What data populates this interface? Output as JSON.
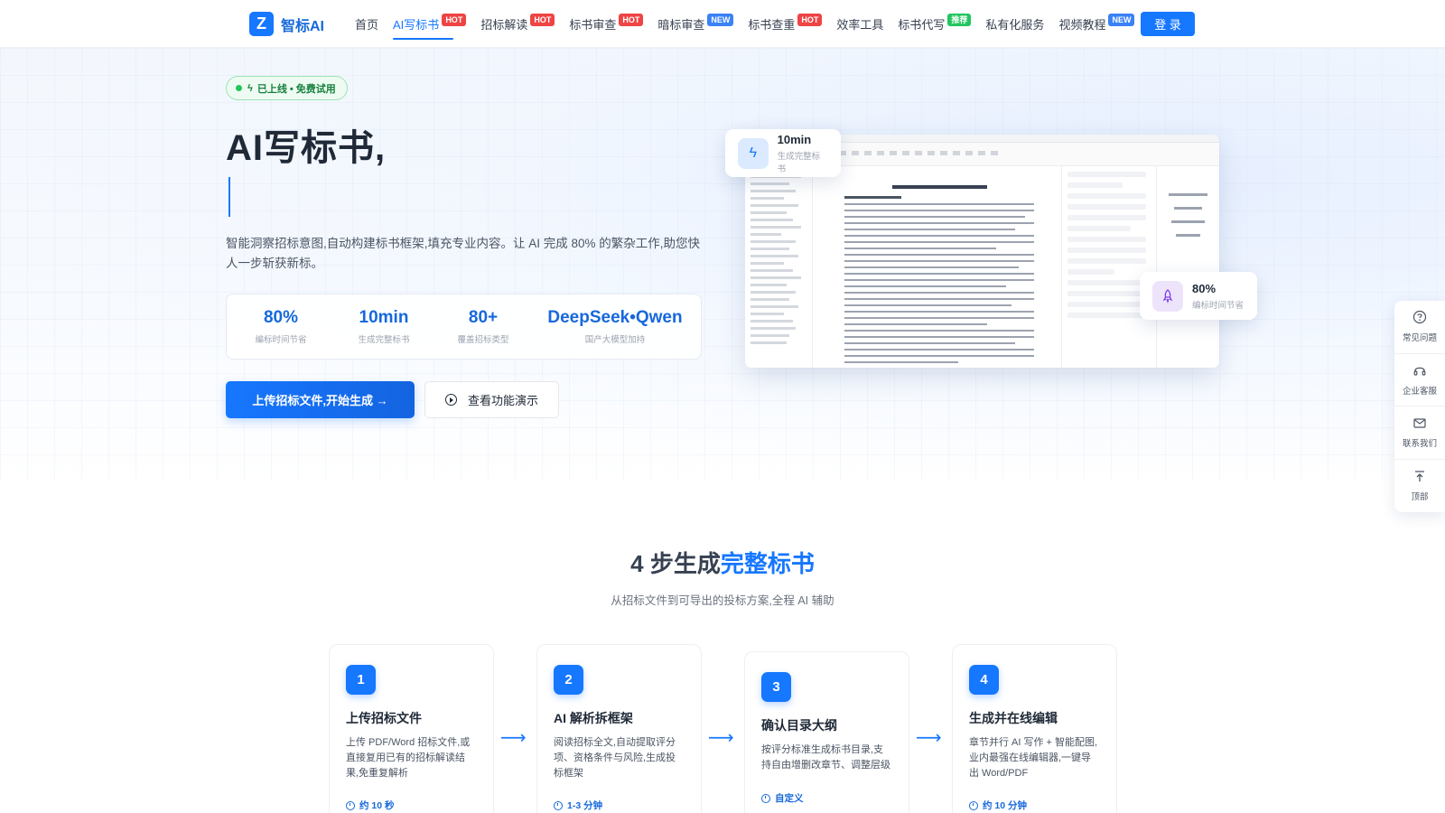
{
  "nav": {
    "logo_mark": "Z",
    "logo_text": "智标AI",
    "items": [
      {
        "label": "首页",
        "badge": ""
      },
      {
        "label": "AI写标书",
        "badge": "HOT"
      },
      {
        "label": "招标解读",
        "badge": "HOT"
      },
      {
        "label": "标书审查",
        "badge": "HOT"
      },
      {
        "label": "暗标审查",
        "badge": "NEW"
      },
      {
        "label": "标书查重",
        "badge": "HOT"
      },
      {
        "label": "效率工具",
        "badge": ""
      },
      {
        "label": "标书代写",
        "badge": "推荐"
      },
      {
        "label": "私有化服务",
        "badge": ""
      },
      {
        "label": "视频教程",
        "badge": "NEW"
      }
    ],
    "login": "登 录"
  },
  "hero": {
    "pill": "已上线 • 免费试用",
    "title": "AI写标书,",
    "desc": "智能洞察招标意图,自动构建标书框架,填充专业内容。让 AI 完成 80% 的繁杂工作,助您快人一步斩获新标。",
    "stats": [
      {
        "value": "80%",
        "label": "编标时间节省"
      },
      {
        "value": "10min",
        "label": "生成完整标书"
      },
      {
        "value": "80+",
        "label": "覆盖招标类型"
      },
      {
        "value": "DeepSeek•Qwen",
        "label": "国产大模型加持"
      }
    ],
    "primary_btn": "上传招标文件,开始生成 →",
    "secondary_btn": "查看功能演示",
    "float1": {
      "value": "10min",
      "label": "生成完整标书"
    },
    "float2": {
      "value": "80%",
      "label": "编标时间节省"
    }
  },
  "side_tools": [
    {
      "icon": "question-icon",
      "label": "常见问题"
    },
    {
      "icon": "headset-icon",
      "label": "企业客服"
    },
    {
      "icon": "mail-icon",
      "label": "联系我们"
    },
    {
      "icon": "to-top-icon",
      "label": "顶部"
    }
  ],
  "steps_section": {
    "title_plain": "4 步生成",
    "title_highlight": "完整标书",
    "subtitle": "从招标文件到可导出的投标方案,全程 AI 辅助",
    "steps": [
      {
        "num": "1",
        "title": "上传招标文件",
        "desc": "上传 PDF/Word 招标文件,或直接复用已有的招标解读结果,免重复解析",
        "meta": "约 10 秒"
      },
      {
        "num": "2",
        "title": "AI 解析拆框架",
        "desc": "阅读招标全文,自动提取评分项、资格条件与风险,生成投标框架",
        "meta": "1-3 分钟"
      },
      {
        "num": "3",
        "title": "确认目录大纲",
        "desc": "按评分标准生成标书目录,支持自由增删改章节、调整层级",
        "meta": "自定义"
      },
      {
        "num": "4",
        "title": "生成并在线编辑",
        "desc": "章节并行 AI 写作 + 智能配图,业内最强在线编辑器,一键导出 Word/PDF",
        "meta": "约 10 分钟"
      }
    ]
  },
  "colors": {
    "accent": "#1677ff",
    "hot": "#ef4444",
    "new": "#3b82f6",
    "recommend": "#22c55e",
    "success": "#22c55e"
  }
}
